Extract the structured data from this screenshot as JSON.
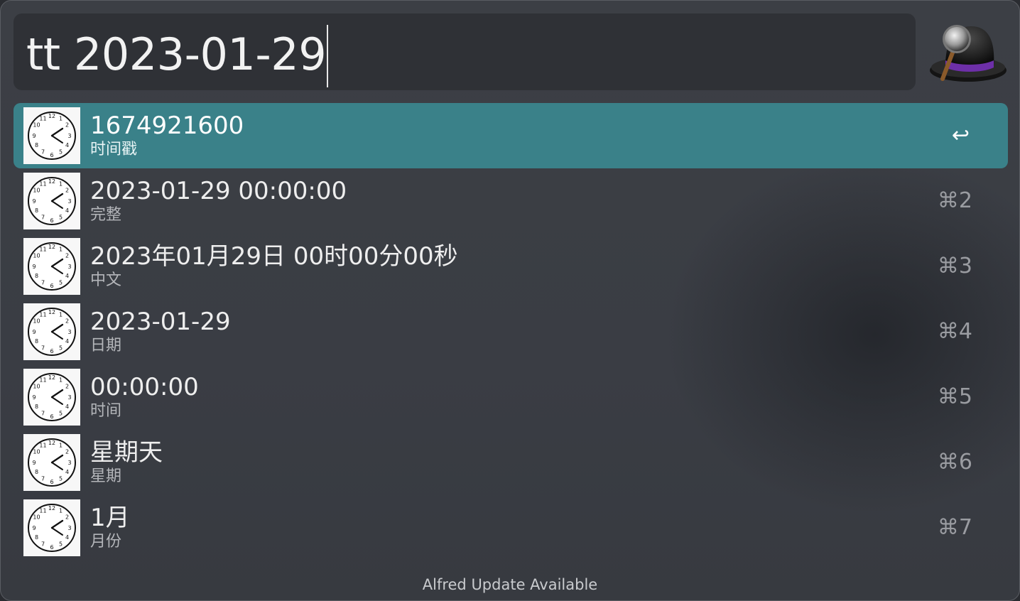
{
  "search": {
    "query": "tt 2023-01-29"
  },
  "results": [
    {
      "title": "1674921600",
      "subtitle": "时间戳",
      "shortcut": "↩",
      "icon": "clock-icon",
      "selected": true
    },
    {
      "title": "2023-01-29 00:00:00",
      "subtitle": "完整",
      "shortcut": "⌘2",
      "icon": "clock-icon"
    },
    {
      "title": "2023年01月29日 00时00分00秒",
      "subtitle": "中文",
      "shortcut": "⌘3",
      "icon": "clock-icon"
    },
    {
      "title": "2023-01-29",
      "subtitle": "日期",
      "shortcut": "⌘4",
      "icon": "clock-icon"
    },
    {
      "title": "00:00:00",
      "subtitle": "时间",
      "shortcut": "⌘5",
      "icon": "clock-icon"
    },
    {
      "title": "星期天",
      "subtitle": "星期",
      "shortcut": "⌘6",
      "icon": "clock-icon"
    },
    {
      "title": "1月",
      "subtitle": "月份",
      "shortcut": "⌘7",
      "icon": "clock-icon"
    }
  ],
  "footer": {
    "text": "Alfred Update Available"
  },
  "colors": {
    "selected_row": "#3a8189",
    "window_bg": "#3c3f45",
    "search_bg": "#2f3136"
  },
  "icons": {
    "logo": "alfred-hat-icon",
    "result": "clock-icon"
  }
}
